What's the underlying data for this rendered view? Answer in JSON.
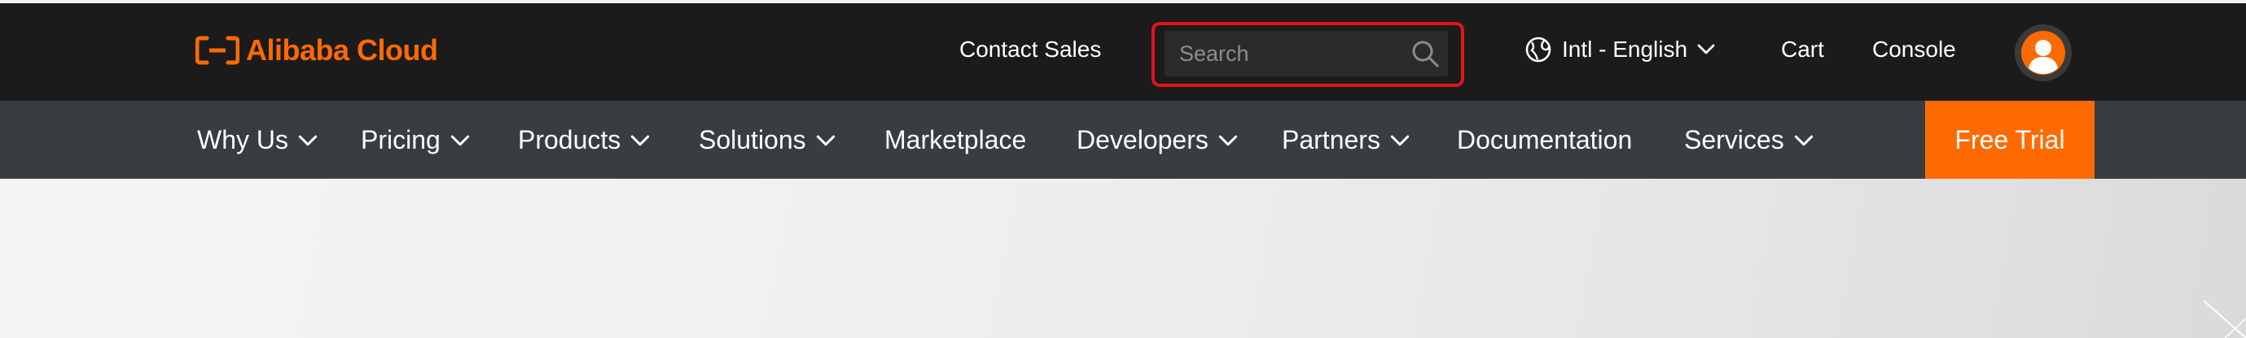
{
  "brand": {
    "name": "Alibaba Cloud",
    "color": "#ff6a00"
  },
  "header": {
    "contact_sales": "Contact Sales",
    "search": {
      "placeholder": "Search",
      "value": ""
    },
    "language": {
      "label": "Intl - English",
      "icon": "globe-icon"
    },
    "cart": "Cart",
    "console": "Console",
    "avatar_icon": "user-avatar-icon"
  },
  "nav": {
    "items": [
      {
        "label": "Why Us",
        "has_dropdown": true
      },
      {
        "label": "Pricing",
        "has_dropdown": true
      },
      {
        "label": "Products",
        "has_dropdown": true
      },
      {
        "label": "Solutions",
        "has_dropdown": true
      },
      {
        "label": "Marketplace",
        "has_dropdown": false
      },
      {
        "label": "Developers",
        "has_dropdown": true
      },
      {
        "label": "Partners",
        "has_dropdown": true
      },
      {
        "label": "Documentation",
        "has_dropdown": false
      },
      {
        "label": "Services",
        "has_dropdown": true
      }
    ],
    "cta": "Free Trial"
  },
  "colors": {
    "topbar": "#1b1b1b",
    "navbar": "#373d41",
    "accent": "#ff6a00",
    "search_highlight": "#e0151b"
  }
}
